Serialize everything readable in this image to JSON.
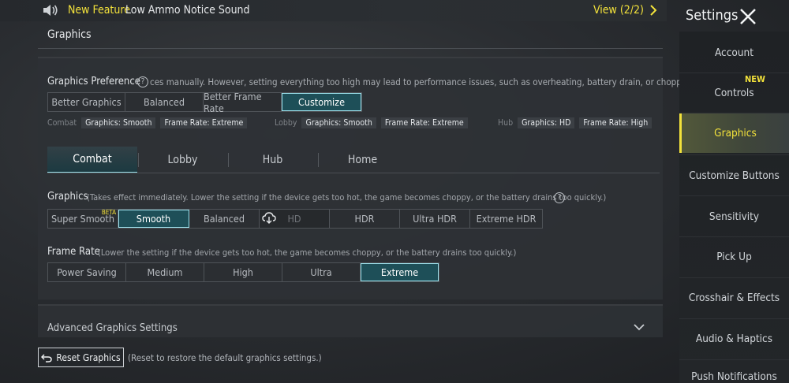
{
  "notice": {
    "highlight": "New Feature",
    "feature": "Low Ammo Notice Sound",
    "view": "View (2/2)"
  },
  "header": {
    "title": "Settings"
  },
  "section": {
    "title": "Graphics"
  },
  "preference": {
    "label": "Graphics Preference",
    "description": "ces manually. However, setting everything too high may lead to performance issues, such as overheating, battery drain, or choppy gameplay",
    "options": [
      "Better Graphics",
      "Balanced",
      "Better Frame Rate",
      "Customize"
    ],
    "selected": "Customize",
    "summary": [
      {
        "label": "Combat",
        "graphics": "Graphics: Smooth",
        "frame_rate": "Frame Rate: Extreme"
      },
      {
        "label": "Lobby",
        "graphics": "Graphics: Smooth",
        "frame_rate": "Frame Rate: Extreme"
      },
      {
        "label": "Hub",
        "graphics": "Graphics: HD",
        "frame_rate": "Frame Rate: High"
      }
    ]
  },
  "tabs": {
    "items": [
      "Combat",
      "Lobby",
      "Hub",
      "Home"
    ],
    "active": "Combat"
  },
  "graphics": {
    "label": "Graphics",
    "description": "(Takes effect immediately. Lower the setting if the device gets too hot, the game becomes choppy, or the battery drains too quickly.)",
    "options": [
      "Super Smooth",
      "Smooth",
      "Balanced",
      "HD",
      "HDR",
      "Ultra HDR",
      "Extreme HDR"
    ],
    "beta": "BETA",
    "selected": "Smooth"
  },
  "frame_rate": {
    "label": "Frame Rate",
    "description": "(Lower the setting if the device gets too hot, the game becomes choppy, or the battery drains too quickly.)",
    "options": [
      "Power Saving",
      "Medium",
      "High",
      "Ultra",
      "Extreme"
    ],
    "selected": "Extreme"
  },
  "advanced": {
    "label": "Advanced Graphics Settings"
  },
  "reset": {
    "label": "Reset Graphics",
    "description": "(Reset to restore the default graphics settings.)"
  },
  "sidebar": {
    "items": [
      {
        "label": "Account"
      },
      {
        "label": "Controls",
        "badge": "NEW"
      },
      {
        "label": "Graphics"
      },
      {
        "label": "Customize Buttons"
      },
      {
        "label": "Sensitivity"
      },
      {
        "label": "Pick Up"
      },
      {
        "label": "Crosshair & Effects"
      },
      {
        "label": "Audio & Haptics"
      },
      {
        "label": "Push Notifications"
      }
    ],
    "active": "Graphics"
  },
  "colors": {
    "accent": "#9fe3ee",
    "highlight": "#f3e23b",
    "selected_bg": "#1e4f58"
  }
}
